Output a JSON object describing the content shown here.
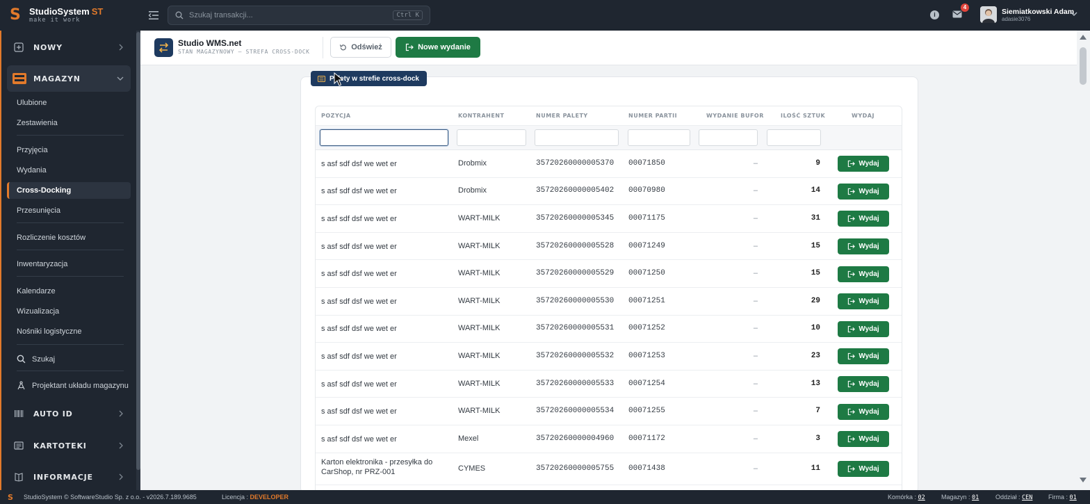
{
  "brand": {
    "name": "StudioSystem",
    "suffix": "ST",
    "tagline": "make it work"
  },
  "search": {
    "placeholder": "Szukaj transakcji...",
    "shortcut": "Ctrl K"
  },
  "notifications": {
    "count": "4"
  },
  "user": {
    "name": "Siemiatkowski Adam",
    "login": "adasie3076"
  },
  "sidebar": {
    "new_label": "NOWY",
    "magazyn_label": "MAGAZYN",
    "items": [
      {
        "label": "Ulubione"
      },
      {
        "label": "Zestawienia"
      },
      {
        "label": "Przyjęcia"
      },
      {
        "label": "Wydania"
      },
      {
        "label": "Cross-Docking"
      },
      {
        "label": "Przesunięcia"
      },
      {
        "label": "Rozliczenie kosztów"
      },
      {
        "label": "Inwentaryzacja"
      },
      {
        "label": "Kalendarze"
      },
      {
        "label": "Wizualizacja"
      },
      {
        "label": "Nośniki logistyczne"
      }
    ],
    "search_label": "Szukaj",
    "designer_label": "Projektant układu magazynu",
    "autoid_label": "AUTO ID",
    "kartoteki_label": "KARTOTEKI",
    "informacje_label": "INFORMACJE"
  },
  "header": {
    "title": "Studio WMS.net",
    "subtitle": "STAN MAGAZYNOWY — STREFA CROSS-DOCK",
    "refresh_label": "Odśwież",
    "new_issue_label": "Nowe wydanie"
  },
  "card": {
    "badge": "Palety w strefie cross-dock"
  },
  "table": {
    "columns": [
      "POZYCJA",
      "KONTRAHENT",
      "NUMER PALETY",
      "NUMER PARTII",
      "WYDANIE BUFOR",
      "ILOŚĆ SZTUK",
      "WYDAJ"
    ],
    "action_label": "Wydaj",
    "rows": [
      {
        "pozycja": "s asf sdf dsf we wet er",
        "kontrahent": "Drobmix",
        "paleta": "35720260000005370",
        "partia": "00071850",
        "bufor": "–",
        "ilosc": "9"
      },
      {
        "pozycja": "s asf sdf dsf we wet er",
        "kontrahent": "Drobmix",
        "paleta": "35720260000005402",
        "partia": "00070980",
        "bufor": "–",
        "ilosc": "14"
      },
      {
        "pozycja": "s asf sdf dsf we wet er",
        "kontrahent": "WART-MILK",
        "paleta": "35720260000005345",
        "partia": "00071175",
        "bufor": "–",
        "ilosc": "31"
      },
      {
        "pozycja": "s asf sdf dsf we wet er",
        "kontrahent": "WART-MILK",
        "paleta": "35720260000005528",
        "partia": "00071249",
        "bufor": "–",
        "ilosc": "15"
      },
      {
        "pozycja": "s asf sdf dsf we wet er",
        "kontrahent": "WART-MILK",
        "paleta": "35720260000005529",
        "partia": "00071250",
        "bufor": "–",
        "ilosc": "15"
      },
      {
        "pozycja": "s asf sdf dsf we wet er",
        "kontrahent": "WART-MILK",
        "paleta": "35720260000005530",
        "partia": "00071251",
        "bufor": "–",
        "ilosc": "29"
      },
      {
        "pozycja": "s asf sdf dsf we wet er",
        "kontrahent": "WART-MILK",
        "paleta": "35720260000005531",
        "partia": "00071252",
        "bufor": "–",
        "ilosc": "10"
      },
      {
        "pozycja": "s asf sdf dsf we wet er",
        "kontrahent": "WART-MILK",
        "paleta": "35720260000005532",
        "partia": "00071253",
        "bufor": "–",
        "ilosc": "23"
      },
      {
        "pozycja": "s asf sdf dsf we wet er",
        "kontrahent": "WART-MILK",
        "paleta": "35720260000005533",
        "partia": "00071254",
        "bufor": "–",
        "ilosc": "13"
      },
      {
        "pozycja": "s asf sdf dsf we wet er",
        "kontrahent": "WART-MILK",
        "paleta": "35720260000005534",
        "partia": "00071255",
        "bufor": "–",
        "ilosc": "7"
      },
      {
        "pozycja": "s asf sdf dsf we wet er",
        "kontrahent": "Mexel",
        "paleta": "35720260000004960",
        "partia": "00071172",
        "bufor": "–",
        "ilosc": "3"
      },
      {
        "pozycja": "Karton elektronika - przesyłka do CarShop, nr PRZ-001",
        "kontrahent": "CYMES",
        "paleta": "35720260000005755",
        "partia": "00071438",
        "bufor": "–",
        "ilosc": "11"
      }
    ]
  },
  "footer": {
    "copyright": "StudioSystem © SoftwareStudio Sp. z o.o. - v2026.7.189.9685",
    "license_label": "Licencja :",
    "license_value": "DEVELOPER",
    "komorka_label": "Komórka :",
    "komorka_value": "02",
    "magazyn_label": "Magazyn :",
    "magazyn_value": "01",
    "oddzial_label": "Oddział :",
    "oddzial_value": "CEN",
    "firma_label": "Firma :",
    "firma_value": "01"
  },
  "colors": {
    "accent": "#e27a2b",
    "primary_green": "#1e7a44",
    "navy": "#1e3a5f",
    "dark_bg": "#1f2630"
  }
}
